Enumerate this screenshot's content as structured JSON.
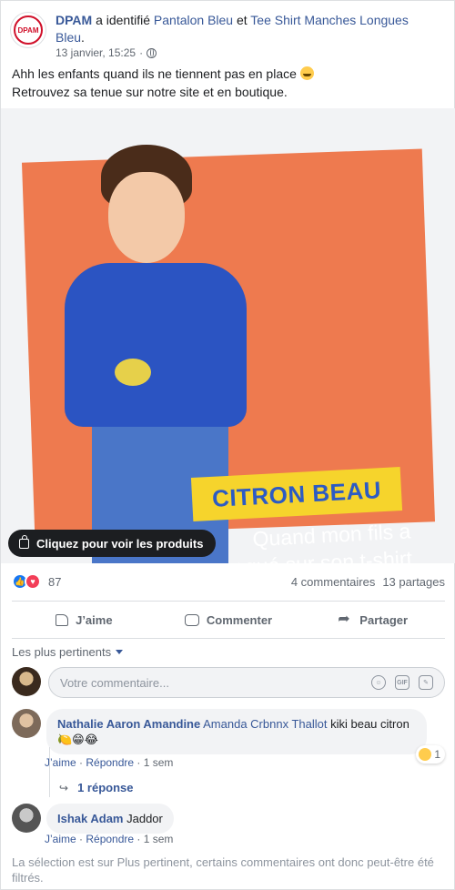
{
  "post": {
    "page_name": "DPAM",
    "identified_text": " a identifié ",
    "product_1": "Pantalon Bleu",
    "and_text": " et ",
    "product_2": "Tee Shirt Manches Longues Bleu",
    "period": ".",
    "date": "13 janvier, 15:25",
    "dot": "·",
    "text_line1": "Ahh les enfants quand ils ne tiennent pas en place",
    "text_line2": "Retrouvez sa tenue sur notre site et en boutique.",
    "avatar_logo_text": "DPAM"
  },
  "image": {
    "banner": "CITRON BEAU",
    "tagline": "Quand mon fils a craqué sur son t-shirt vitaminé.",
    "products_button": "Cliquez pour voir les produits"
  },
  "summary": {
    "reactions_count": "87",
    "comments": "4 commentaires",
    "shares": "13 partages"
  },
  "actions": {
    "like": "J’aime",
    "comment": "Commenter",
    "share": "Partager"
  },
  "sort_label": "Les plus pertinents",
  "compose_placeholder": "Votre commentaire...",
  "compose_icons": {
    "gif": "GIF"
  },
  "comments": [
    {
      "author": "Nathalie Aaron Amandine",
      "tag": "Amanda Crbnnx Thallot",
      "text": " kiki beau citron ",
      "emojis": "🍋😁😂",
      "like": "J’aime",
      "reply": "Répondre",
      "time": "1 sem",
      "reaction_count": "1"
    },
    {
      "author": "Ishak Adam",
      "text": " Jaddor",
      "like": "J’aime",
      "reply": "Répondre",
      "time": "1 sem"
    }
  ],
  "replies_link": "1 réponse",
  "filter_note": "La sélection est sur Plus pertinent, certains commentaires ont donc peut-être été filtrés.",
  "colors": {
    "link": "#385898",
    "like_blue": "#1877f2",
    "love_red": "#f33e58",
    "banner_yellow": "#f6d42c",
    "photo_orange": "#ee7a4f"
  }
}
